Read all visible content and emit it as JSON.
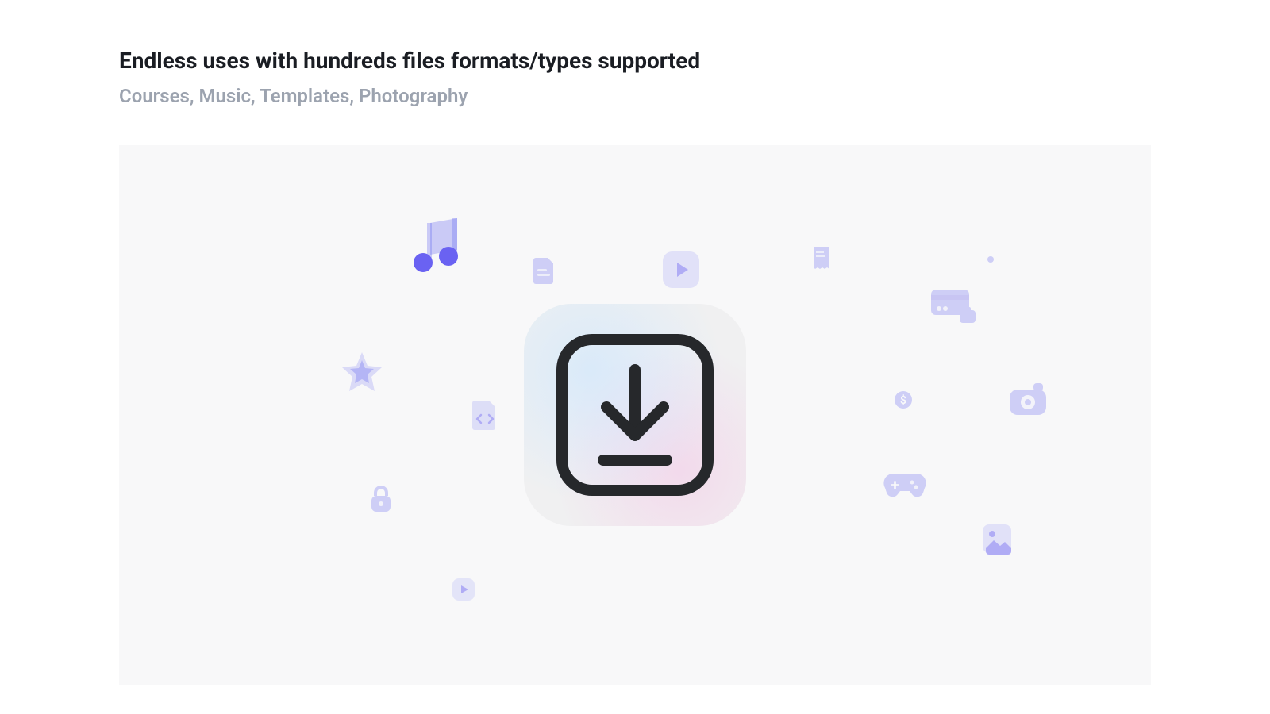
{
  "header": {
    "title": "Endless uses with hundreds files formats/types supported",
    "subtitle": "Courses, Music, Templates, Photography"
  },
  "icons": {
    "center": "download",
    "floating": [
      "music-note",
      "document",
      "play",
      "receipt",
      "dot",
      "star",
      "code",
      "dollar",
      "credit-card",
      "camera",
      "lock",
      "gamepad",
      "image",
      "play-small"
    ]
  }
}
